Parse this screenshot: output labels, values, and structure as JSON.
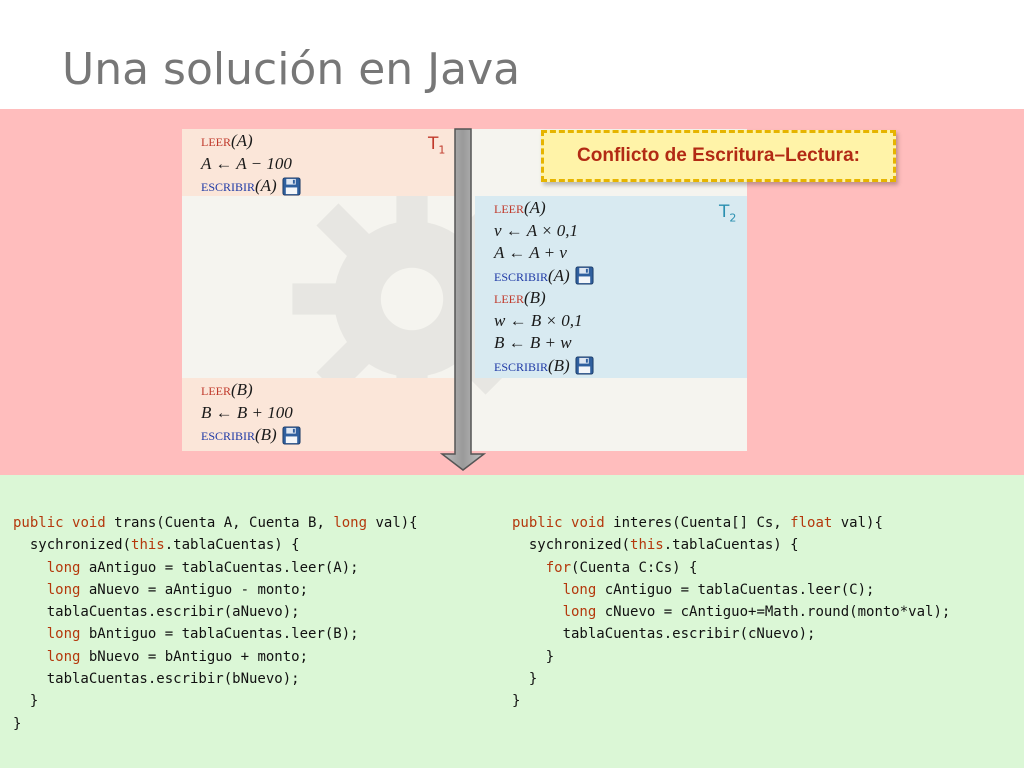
{
  "slide": {
    "title": "Una solución en Java"
  },
  "transactions": {
    "t1": {
      "label": "T",
      "sub": "1",
      "block_a": [
        {
          "type": "op",
          "kw": "leer",
          "kw_kind": "read",
          "arg": "(A)",
          "disk": false
        },
        {
          "type": "expr",
          "text": "A ← A − 100"
        },
        {
          "type": "op",
          "kw": "escribir",
          "kw_kind": "write",
          "arg": "(A)",
          "disk": true
        }
      ],
      "block_b": [
        {
          "type": "op",
          "kw": "leer",
          "kw_kind": "read",
          "arg": "(B)",
          "disk": false
        },
        {
          "type": "expr",
          "text": "B ← B + 100"
        },
        {
          "type": "op",
          "kw": "escribir",
          "kw_kind": "write",
          "arg": "(B)",
          "disk": true
        }
      ]
    },
    "t2": {
      "label": "T",
      "sub": "2",
      "block": [
        {
          "type": "op",
          "kw": "leer",
          "kw_kind": "read",
          "arg": "(A)",
          "disk": false
        },
        {
          "type": "expr",
          "text": "v ← A × 0,1"
        },
        {
          "type": "expr",
          "text": "A ← A + v"
        },
        {
          "type": "op",
          "kw": "escribir",
          "kw_kind": "write",
          "arg": "(A)",
          "disk": true
        },
        {
          "type": "op",
          "kw": "leer",
          "kw_kind": "read",
          "arg": "(B)",
          "disk": false
        },
        {
          "type": "expr",
          "text": "w ← B × 0,1"
        },
        {
          "type": "expr",
          "text": "B ← B + w"
        },
        {
          "type": "op",
          "kw": "escribir",
          "kw_kind": "write",
          "arg": "(B)",
          "disk": true
        }
      ]
    }
  },
  "callout": {
    "text": "Conflicto de Escritura–Lectura:"
  },
  "icons": {
    "disk": "floppy-disk-icon",
    "arrow": "down-arrow-icon",
    "gear": "gear-icon"
  },
  "colors": {
    "red_band": "#ffbdbd",
    "green_band": "#dbf7d6",
    "t1_bg": "#fbe6d9",
    "t2_bg": "#d8eaf1",
    "read_kw": "#c0392b",
    "write_kw": "#1f3aa6",
    "java_keyword": "#b4380c",
    "callout_bg": "#fff3a8",
    "callout_border": "#e6b400",
    "callout_text": "#b22a14"
  },
  "code": {
    "left": [
      [
        [
          "jk",
          "public"
        ],
        [
          "t",
          " "
        ],
        [
          "jk",
          "void"
        ],
        [
          "t",
          " trans(Cuenta A, Cuenta B, "
        ],
        [
          "jk",
          "long"
        ],
        [
          "t",
          " val){"
        ]
      ],
      [
        [
          "t",
          "  sychronized("
        ],
        [
          "jk",
          "this"
        ],
        [
          "t",
          ".tablaCuentas) {"
        ]
      ],
      [
        [
          "t",
          "    "
        ],
        [
          "jk",
          "long"
        ],
        [
          "t",
          " aAntiguo = tablaCuentas.leer(A);"
        ]
      ],
      [
        [
          "t",
          "    "
        ],
        [
          "jk",
          "long"
        ],
        [
          "t",
          " aNuevo = aAntiguo - monto;"
        ]
      ],
      [
        [
          "t",
          "    tablaCuentas.escribir(aNuevo);"
        ]
      ],
      [
        [
          "t",
          "    "
        ],
        [
          "jk",
          "long"
        ],
        [
          "t",
          " bAntiguo = tablaCuentas.leer(B);"
        ]
      ],
      [
        [
          "t",
          "    "
        ],
        [
          "jk",
          "long"
        ],
        [
          "t",
          " bNuevo = bAntiguo + monto;"
        ]
      ],
      [
        [
          "t",
          "    tablaCuentas.escribir(bNuevo);"
        ]
      ],
      [
        [
          "t",
          "  }"
        ]
      ],
      [
        [
          "t",
          "}"
        ]
      ]
    ],
    "right": [
      [
        [
          "jk",
          "public"
        ],
        [
          "t",
          " "
        ],
        [
          "jk",
          "void"
        ],
        [
          "t",
          " interes(Cuenta[] Cs, "
        ],
        [
          "jk",
          "float"
        ],
        [
          "t",
          " val){"
        ]
      ],
      [
        [
          "t",
          "  sychronized("
        ],
        [
          "jk",
          "this"
        ],
        [
          "t",
          ".tablaCuentas) {"
        ]
      ],
      [
        [
          "t",
          "    "
        ],
        [
          "jk",
          "for"
        ],
        [
          "t",
          "(Cuenta C:Cs) {"
        ]
      ],
      [
        [
          "t",
          "      "
        ],
        [
          "jk",
          "long"
        ],
        [
          "t",
          " cAntiguo = tablaCuentas.leer(C);"
        ]
      ],
      [
        [
          "t",
          "      "
        ],
        [
          "jk",
          "long"
        ],
        [
          "t",
          " cNuevo = cAntiguo+=Math.round(monto*val);"
        ]
      ],
      [
        [
          "t",
          "      tablaCuentas.escribir(cNuevo);"
        ]
      ],
      [
        [
          "t",
          "    }"
        ]
      ],
      [
        [
          "t",
          "  }"
        ]
      ],
      [
        [
          "t",
          "}"
        ]
      ]
    ]
  }
}
